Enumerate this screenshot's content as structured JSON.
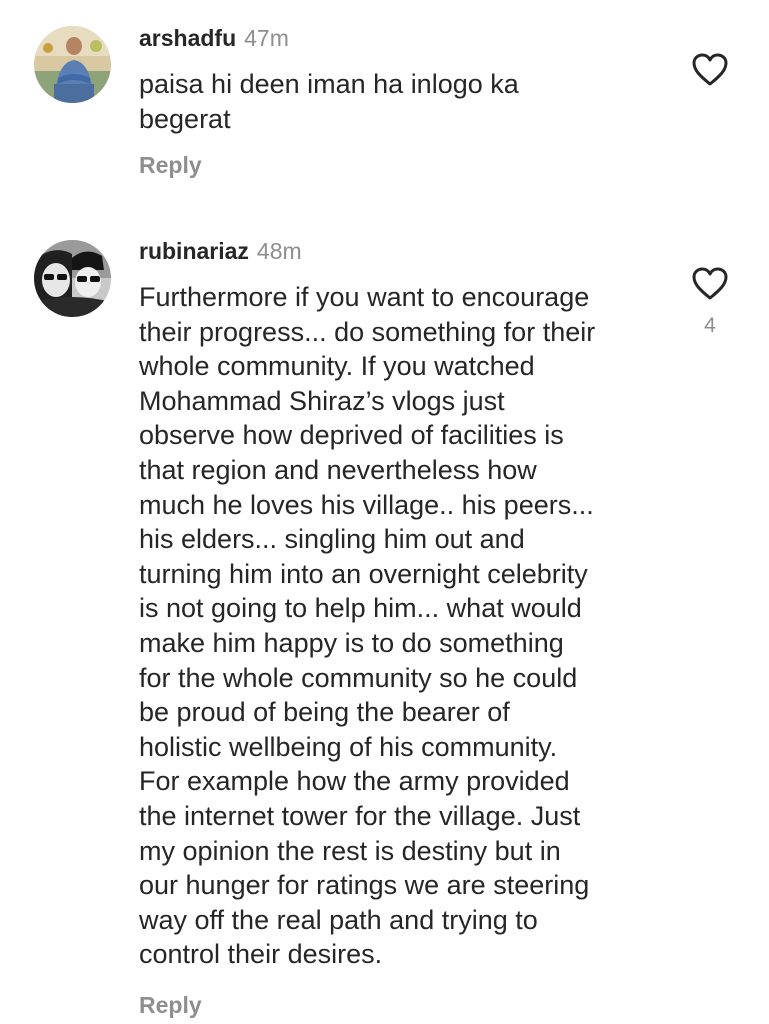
{
  "comments": [
    {
      "username": "arshadfu",
      "time": "47m",
      "lines": [
        "paisa hi deen iman ha inlogo ka",
        "begerat"
      ],
      "reply_label": "Reply",
      "like_icon": "heart-outline-icon",
      "like_count": ""
    },
    {
      "username": "rubinariaz",
      "time": "48m",
      "lines": [
        "Furthermore if you want to encourage",
        "their progress... do something for their",
        "whole community. If you watched",
        "Mohammad Shiraz’s vlogs just",
        "observe how deprived of facilities is",
        "that region and nevertheless how",
        "much he loves his village.. his peers...",
        "his elders... singling him out and",
        "turning him into an overnight celebrity",
        "is not going to help him... what would",
        "make him happy is to do something",
        "for the whole community so he could",
        "be proud of being the bearer of",
        "holistic wellbeing of his community.",
        "For example how the army provided",
        "the internet tower for the village. Just",
        "my opinion the rest is destiny but in",
        "our hunger for ratings we are steering",
        "way off the real path and trying to",
        "control their desires."
      ],
      "reply_label": "Reply",
      "like_icon": "heart-outline-icon",
      "like_count": "4"
    }
  ],
  "colors": {
    "text": "#262626",
    "secondary": "#8e8e8e",
    "background": "#ffffff"
  }
}
